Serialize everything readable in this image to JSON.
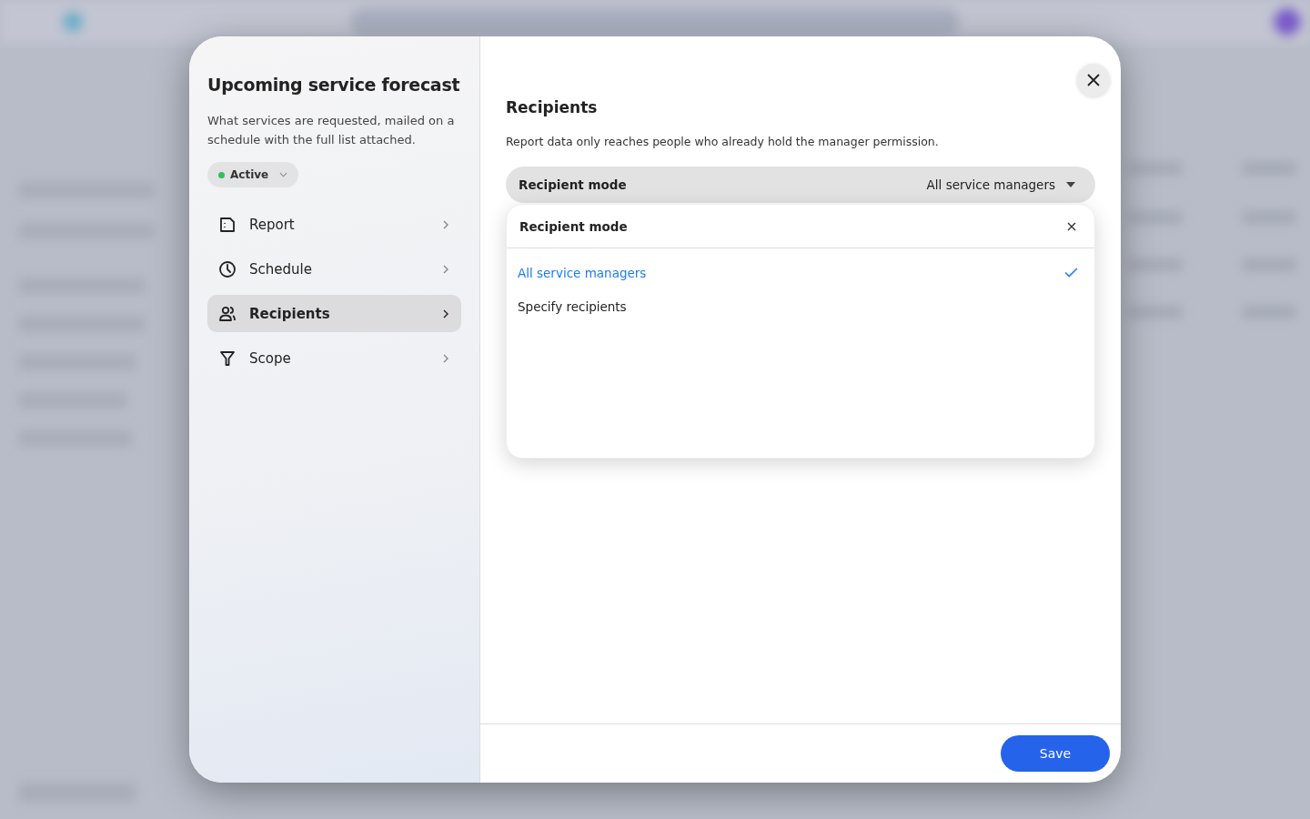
{
  "panel": {
    "title": "Upcoming service forecast",
    "description": "What services are requested, mailed on a schedule with the full list attached.",
    "status": "Active"
  },
  "nav": [
    {
      "kind": "report",
      "label": "Report",
      "selected": false
    },
    {
      "kind": "schedule",
      "label": "Schedule",
      "selected": false
    },
    {
      "kind": "recipients",
      "label": "Recipients",
      "selected": true
    },
    {
      "kind": "scope",
      "label": "Scope",
      "selected": false
    }
  ],
  "section": {
    "title": "Recipients",
    "description": "Report data only reaches people who already hold the manager permission."
  },
  "select": {
    "label": "Recipient mode",
    "value": "All service managers",
    "expanded": true
  },
  "dropdown": {
    "title": "Recipient mode",
    "options": [
      {
        "label": "All service managers",
        "selected": true
      },
      {
        "label": "Specify recipients",
        "selected": false
      }
    ]
  },
  "save": "Save"
}
